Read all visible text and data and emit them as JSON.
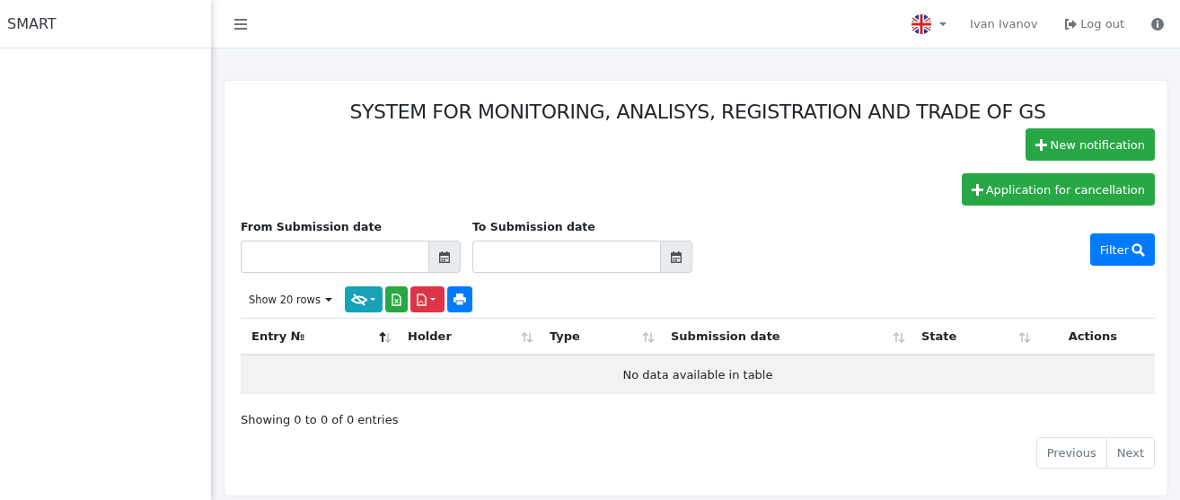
{
  "sidebar": {
    "brand": "SMART"
  },
  "topbar": {
    "user": "Ivan Ivanov",
    "logout": "Log out"
  },
  "card": {
    "title": "SYSTEM FOR MONITORING, ANALISYS, REGISTRATION AND TRADE OF GS",
    "actions": [
      "New notification",
      "Application for cancellation"
    ],
    "filters": [
      {
        "label": "From Submission date"
      },
      {
        "label": "To Submission date"
      }
    ],
    "filter_button": "Filter",
    "page_length": "Show 20 rows",
    "table": {
      "columns": [
        {
          "label": "Entry №",
          "sortable": true,
          "sorted_ascending": true
        },
        {
          "label": "Holder",
          "sortable": true,
          "sorted_ascending": false
        },
        {
          "label": "Type",
          "sortable": true,
          "sorted_ascending": false
        },
        {
          "label": "Submission date",
          "sortable": true,
          "sorted_ascending": false
        },
        {
          "label": "State",
          "sortable": true,
          "sorted_ascending": false
        },
        {
          "label": "Actions",
          "sortable": false
        }
      ],
      "empty": "No data available in table"
    },
    "info": "Showing 0 to 0 of 0 entries",
    "pagination": [
      {
        "label": "Previous",
        "disabled": true
      },
      {
        "label": "Next",
        "disabled": true
      }
    ]
  }
}
